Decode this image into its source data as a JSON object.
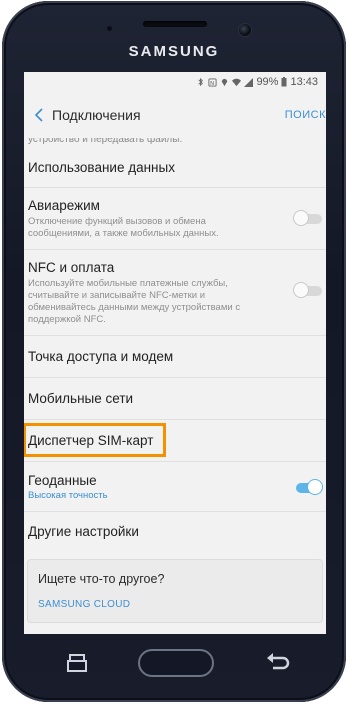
{
  "device": {
    "brand": "SAMSUNG"
  },
  "status_bar": {
    "battery": "99%",
    "time": "13:43"
  },
  "header": {
    "title": "Подключения",
    "search_label": "ПОИСК"
  },
  "partial_text": "устройство и передавать файлы.",
  "items": [
    {
      "title": "Использование данных"
    },
    {
      "title": "Авиарежим",
      "desc": "Отключение функций вызовов и обмена сообщениями, а также мобильных данных.",
      "toggle": "off"
    },
    {
      "title": "NFC и оплата",
      "desc": "Используйте мобильные платежные службы, считывайте и записывайте NFC-метки и обменивайтесь данными между устройствами с поддержкой NFC.",
      "toggle": "off"
    },
    {
      "title": "Точка доступа и модем"
    },
    {
      "title": "Мобильные сети"
    },
    {
      "title": "Диспетчер SIM-карт"
    },
    {
      "title": "Геоданные",
      "sub": "Высокая точность",
      "toggle": "on"
    },
    {
      "title": "Другие настройки"
    }
  ],
  "suggest": {
    "title": "Ищете что-то другое?",
    "link": "SAMSUNG CLOUD"
  },
  "colors": {
    "accent": "#3d8fd1",
    "highlight": "#f39200"
  }
}
